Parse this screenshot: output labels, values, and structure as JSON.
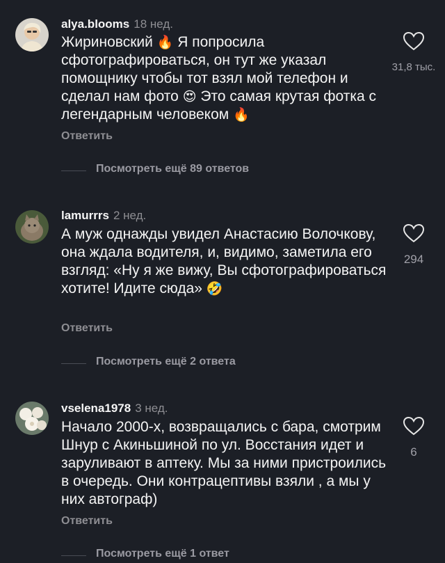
{
  "comments": [
    {
      "username": "alya.blooms",
      "time": "18 нед.",
      "text_parts": [
        "Жириновский ",
        "🔥",
        " Я попросила сфотографироваться, он тут же указал помощнику чтобы тот взял мой телефон и сделал нам фото ",
        "😍",
        " Это самая крутая фотка с легендарным человеком ",
        "🔥"
      ],
      "likes": "31,8 тыс.",
      "reply_label": "Ответить",
      "view_more": "Посмотреть ещё 89 ответов",
      "avatar_icon": "avatar-woman-photo"
    },
    {
      "username": "lamurrrs",
      "time": "2 нед.",
      "text_parts": [
        "А муж однажды увидел Анастасию Волочкову, она ждала водителя, и, видимо, заметила его взгляд: «Ну я же вижу, Вы сфотографироваться хотите! Идите сюда» ",
        "🤣"
      ],
      "likes": "294",
      "reply_label": "Ответить",
      "view_more": "Посмотреть ещё 2 ответа",
      "avatar_icon": "avatar-cat-photo"
    },
    {
      "username": "vselena1978",
      "time": "3 нед.",
      "text_parts": [
        "Начало 2000-х, возвращались с бара, смотрим Шнур с Акиньшиной по ул. Восстания идет и заруливают в аптеку. Мы за ними пристроились в очередь. Они контрацептивы взяли , а мы у них автограф)"
      ],
      "likes": "6",
      "reply_label": "Ответить",
      "view_more": "Посмотреть ещё 1 ответ",
      "avatar_icon": "avatar-flowers-photo"
    }
  ],
  "colors": {
    "background": "#1c1f26",
    "text": "#f4f4f4",
    "secondary": "#8e8e93"
  }
}
